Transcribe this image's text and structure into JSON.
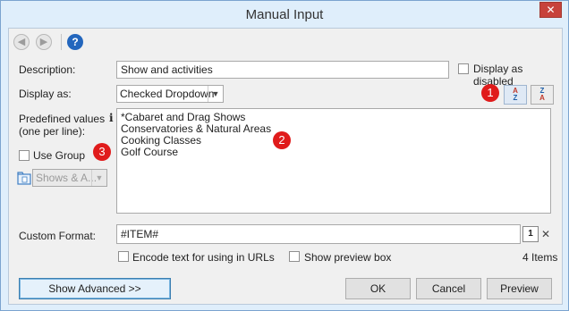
{
  "window": {
    "title": "Manual Input",
    "close_glyph": "✕"
  },
  "toolbar": {
    "back_icon": "arrow-left-icon",
    "forward_icon": "arrow-right-icon",
    "help_glyph": "?"
  },
  "description": {
    "label": "Description:",
    "value": "Show and activities"
  },
  "display_as_disabled": {
    "label": "Display as disabled",
    "checked": false
  },
  "display_as": {
    "label": "Display as:",
    "value": "Checked Dropdown"
  },
  "badges": {
    "one": "1",
    "two": "2",
    "three": "3"
  },
  "sort": {
    "asc_top": "A",
    "asc_bottom": "Z",
    "desc_top": "Z",
    "desc_bottom": "A"
  },
  "predefined": {
    "label_line1": "Predefined values",
    "label_line2": "(one per line):",
    "info_glyph": "i",
    "values": [
      "*Cabaret and Drag Shows",
      "Conservatories & Natural Areas",
      "Cooking Classes",
      "Golf Course"
    ]
  },
  "use_group": {
    "label": "Use Group",
    "checked": false
  },
  "group_select": {
    "value": "Shows & A..."
  },
  "custom_format": {
    "label": "Custom Format:",
    "value": "#ITEM#",
    "insert_label": "1",
    "clear_glyph": "✕"
  },
  "encode": {
    "label": "Encode text for using in URLs",
    "checked": false
  },
  "preview_box": {
    "label": "Show preview box",
    "checked": false
  },
  "item_count": "4 Items",
  "buttons": {
    "advanced": "Show Advanced >>",
    "ok": "OK",
    "cancel": "Cancel",
    "preview": "Preview"
  },
  "colors": {
    "badge": "#e01b1b",
    "help": "#2366bd",
    "close": "#c7423b"
  }
}
